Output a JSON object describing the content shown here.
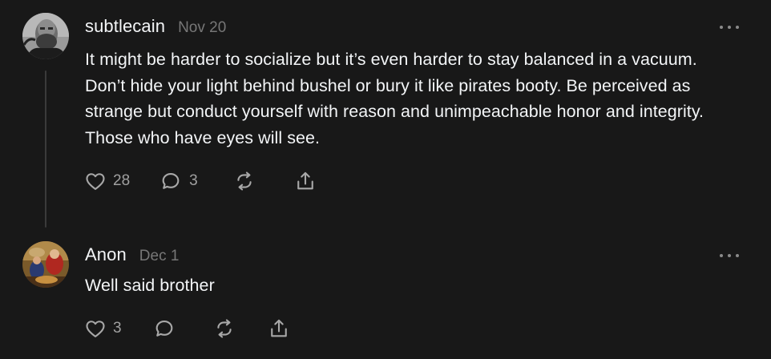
{
  "comments": [
    {
      "username": "subtlecain",
      "date": "Nov 20",
      "text": "It might be harder to socialize but it’s even harder to stay balanced in a vacuum. Don’t hide your light behind bushel or bury it like pirates booty. Be perceived as strange but conduct yourself with reason and unimpeachable honor and integrity. Those who have eyes will see.",
      "likes": "28",
      "replies": "3",
      "avatar_icon": "bearded-man-photo"
    },
    {
      "username": "Anon",
      "date": "Dec 1",
      "text": "Well said brother",
      "likes": "3",
      "avatar_icon": "painting-photo"
    }
  ],
  "icons": {
    "like": "heart-icon",
    "reply": "speech-bubble-icon",
    "restack": "restack-arrows-icon",
    "share": "share-upload-icon",
    "more": "more-dots-icon"
  },
  "colors": {
    "background": "#181818",
    "text": "#f3f5f7",
    "muted": "#777777",
    "icon": "#a8a8a8"
  }
}
